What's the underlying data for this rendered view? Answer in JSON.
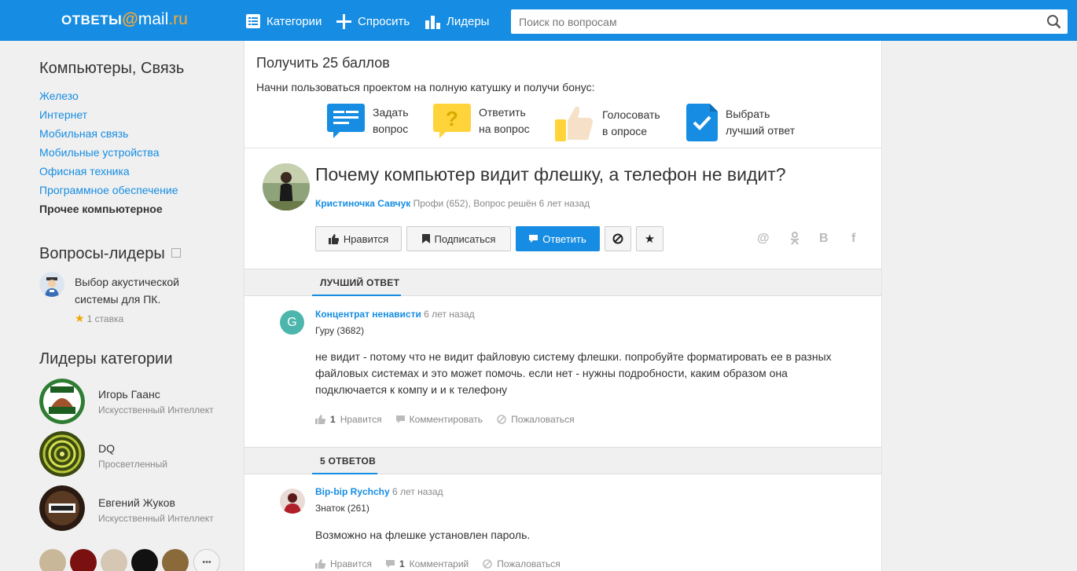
{
  "header": {
    "logo_otvety": "ОТВЕТЫ",
    "logo_at": "@",
    "logo_mail": "mail",
    "logo_ru": ".ru",
    "nav": [
      {
        "label": "Категории",
        "icon": "list-icon"
      },
      {
        "label": "Спросить",
        "icon": "plus-icon"
      },
      {
        "label": "Лидеры",
        "icon": "bar-chart-icon"
      }
    ],
    "search_placeholder": "Поиск по вопросам"
  },
  "sidebar": {
    "category_title": "Компьютеры, Связь",
    "categories": [
      {
        "label": "Железо"
      },
      {
        "label": "Интернет"
      },
      {
        "label": "Мобильная связь"
      },
      {
        "label": "Мобильные устройства"
      },
      {
        "label": "Офисная техника"
      },
      {
        "label": "Программное обеспечение"
      },
      {
        "label": "Прочее компьютерное",
        "active": true
      }
    ],
    "leader_questions_title": "Вопросы-лидеры",
    "leader_question": {
      "text_line1": "Выбор акустической",
      "text_line2": "системы для ПК.",
      "stakes": "1 ставка"
    },
    "category_leaders_title": "Лидеры категории",
    "leaders": [
      {
        "name": "Игорь Гаанс",
        "rank": "Искусственный Интеллект"
      },
      {
        "name": "DQ",
        "rank": "Просветленный"
      },
      {
        "name": "Евгений Жуков",
        "rank": "Искусственный Интеллект"
      }
    ],
    "more_label": "•••"
  },
  "bonus": {
    "title": "Получить 25 баллов",
    "subtitle": "Начни пользоваться проектом на полную катушку и получи бонус:",
    "items": [
      {
        "line1": "Задать",
        "line2": "вопрос"
      },
      {
        "line1": "Ответить",
        "line2": "на вопрос"
      },
      {
        "line1": "Голосовать",
        "line2": "в опросе"
      },
      {
        "line1": "Выбрать",
        "line2": "лучший ответ"
      }
    ]
  },
  "question": {
    "title": "Почему компьютер видит флешку, а телефон не видит?",
    "author": "Кристиночка Савчук",
    "meta": "Профи (652), Вопрос решён 6 лет назад",
    "buttons": {
      "like": "Нравится",
      "subscribe": "Подписаться",
      "answer": "Ответить"
    },
    "share": [
      "@",
      "ok",
      "B",
      "f"
    ]
  },
  "best_answer": {
    "band_label": "ЛУЧШИЙ ОТВЕТ",
    "avatar_letter": "G",
    "author": "Концентрат ненависти",
    "time": "6 лет назад",
    "rank": "Гуру (3682)",
    "text": "не видит - потому что не видит файловую систему флешки. попробуйте форматировать ее в разных файловых системах и это может помочь. если нет - нужны подробности, каким образом она подключается к компу и и к телефону",
    "likes": "1",
    "like_label": "Нравится",
    "comment_label": "Комментировать",
    "report_label": "Пожаловаться"
  },
  "answers": {
    "band_label": "5 ОТВЕТОВ",
    "first": {
      "author": "Bip-bip Rychchy",
      "time": "6 лет назад",
      "rank": "Знаток (261)",
      "text": "Возможно на флешке установлен пароль.",
      "like_label": "Нравится",
      "comments_count": "1",
      "comment_label": "Комментарий",
      "report_label": "Пожаловаться"
    }
  },
  "colors": {
    "accent": "#168de2",
    "logo_orange": "#ffa930",
    "best_avatar": "#4db6ac"
  }
}
